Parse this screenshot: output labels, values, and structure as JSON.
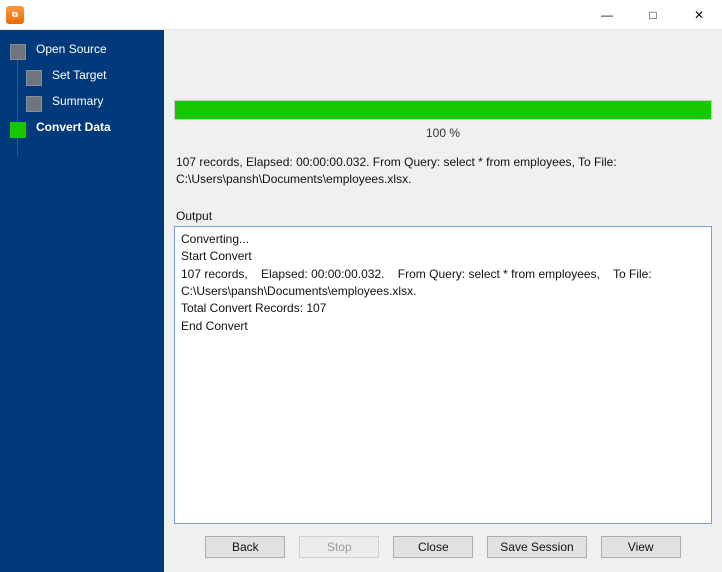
{
  "window": {
    "title": ""
  },
  "sidebar": {
    "items": [
      {
        "label": "Open Source"
      },
      {
        "label": "Set Target"
      },
      {
        "label": "Summary"
      },
      {
        "label": "Convert Data"
      }
    ]
  },
  "progress": {
    "percent": 100,
    "label": "100 %"
  },
  "status": {
    "line1": "107 records,    Elapsed: 00:00:00.032.    From Query: select * from employees,    To File:",
    "line2": "C:\\Users\\pansh\\Documents\\employees.xlsx."
  },
  "output": {
    "label": "Output",
    "text": "Converting...\nStart Convert\n107 records,    Elapsed: 00:00:00.032.    From Query: select * from employees,    To File: C:\\Users\\pansh\\Documents\\employees.xlsx.\nTotal Convert Records: 107\nEnd Convert\n"
  },
  "buttons": {
    "back": "Back",
    "stop": "Stop",
    "close": "Close",
    "save_session": "Save Session",
    "view": "View"
  }
}
